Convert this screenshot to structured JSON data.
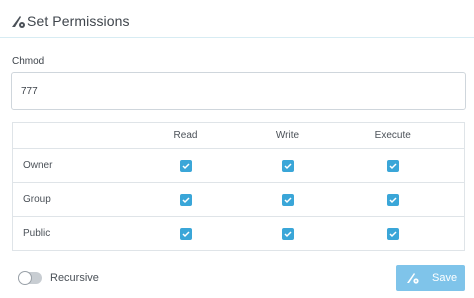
{
  "dialog": {
    "title": "Set Permissions",
    "icon": "pencil-gear-icon"
  },
  "chmod": {
    "label": "Chmod",
    "value": "777"
  },
  "table": {
    "headers": [
      "",
      "Read",
      "Write",
      "Execute"
    ],
    "rows": [
      {
        "label": "Owner",
        "read": true,
        "write": true,
        "execute": true
      },
      {
        "label": "Group",
        "read": true,
        "write": true,
        "execute": true
      },
      {
        "label": "Public",
        "read": true,
        "write": true,
        "execute": true
      }
    ]
  },
  "recursive": {
    "label": "Recursive",
    "enabled": false
  },
  "save": {
    "label": "Save",
    "icon": "pencil-gear-icon"
  },
  "colors": {
    "accent": "#3aa6d8",
    "save_button": "#7fc4ea",
    "divider": "#d7ecf3"
  }
}
